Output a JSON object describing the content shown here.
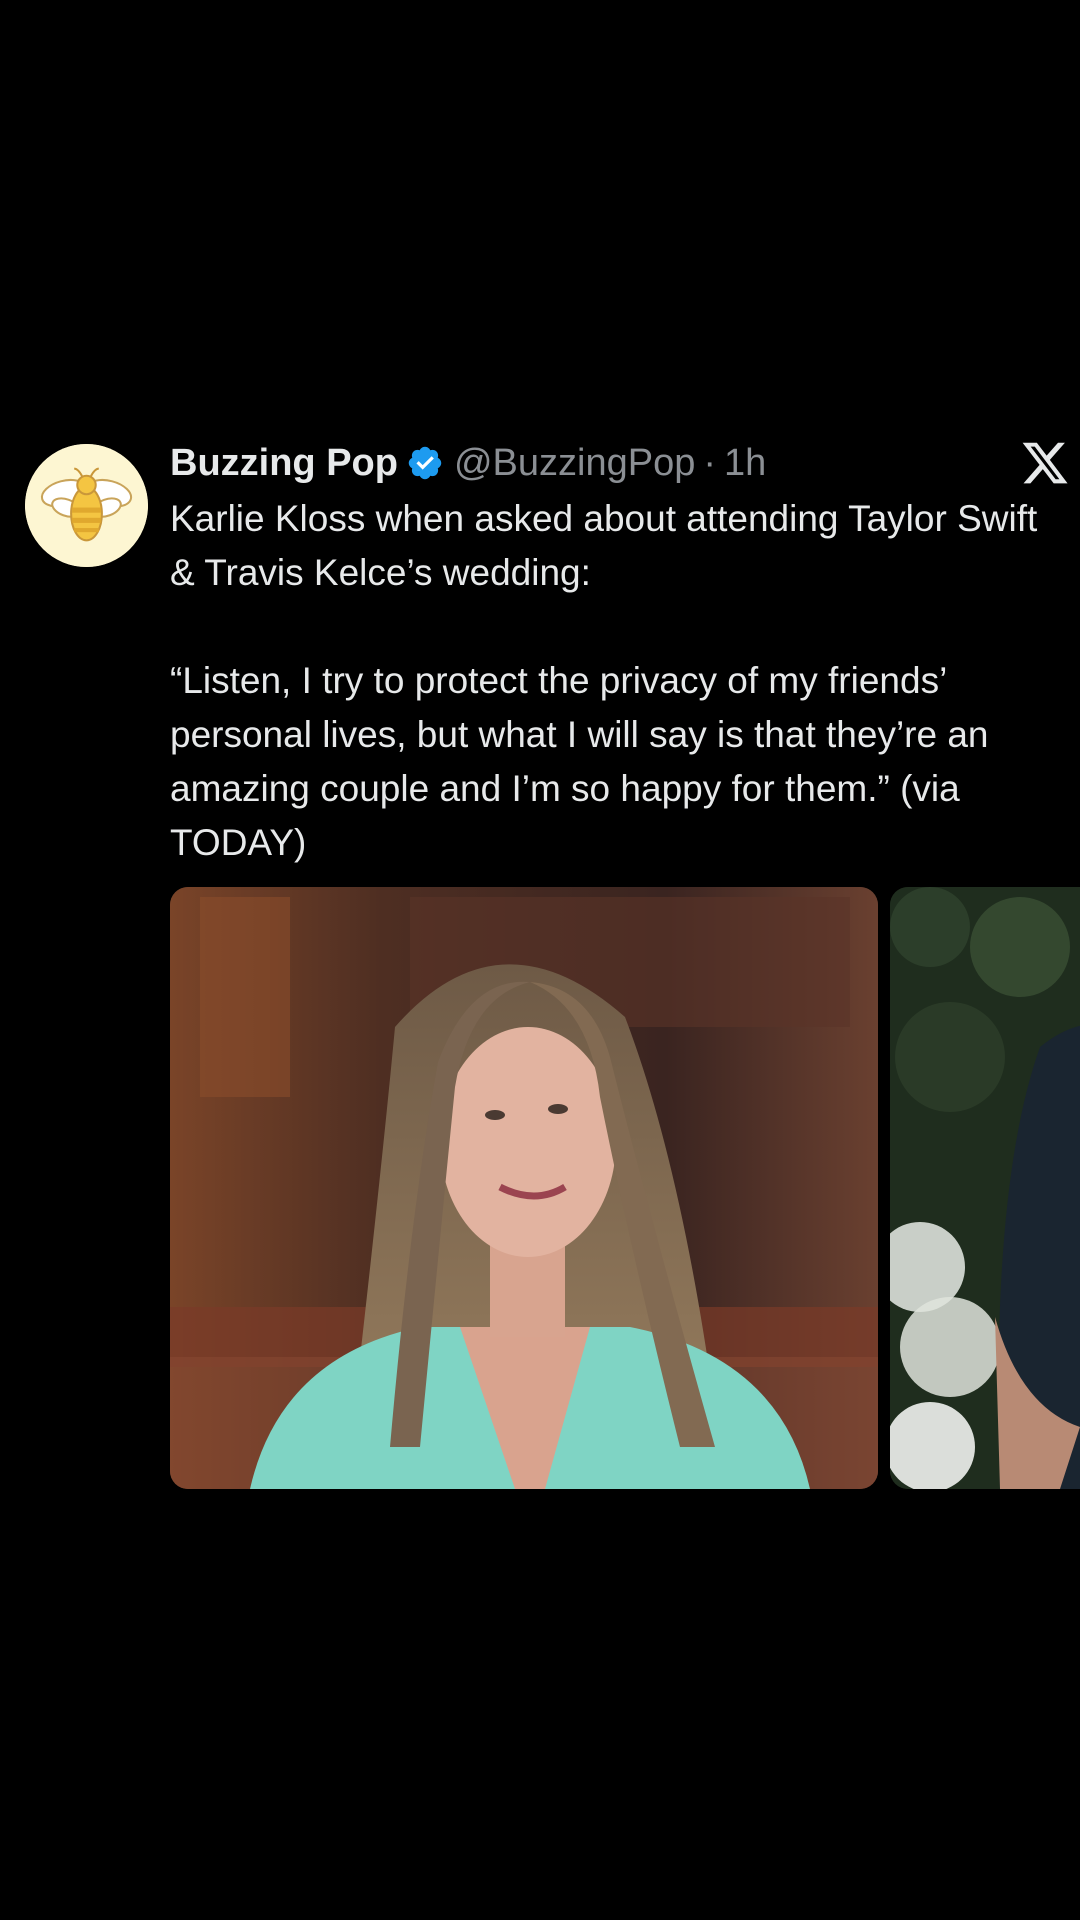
{
  "tweet": {
    "display_name": "Buzzing Pop",
    "handle": "@BuzzingPop",
    "separator": "·",
    "time": "1h",
    "text_line_1": "Karlie Kloss when asked about attending Taylor Swift & Travis Kelce’s wedding:",
    "text_line_2": "“Listen, I try to protect the privacy of my friends’ personal lives, but what I will say is that they’re an amazing couple and I’m so happy for them.” (via TODAY)",
    "avatar_icon": "bee-icon",
    "verified_icon": "verified-badge-icon",
    "brand_icon": "x-logo-icon"
  },
  "media": [
    {
      "kind": "photo",
      "subject": "woman with long hair in teal blazer"
    },
    {
      "kind": "photo",
      "subject": "man in dark shirt near flowers"
    }
  ],
  "colors": {
    "background": "#000000",
    "text_primary": "#e7e9ea",
    "text_secondary": "#8b8f94",
    "verified_blue": "#1d9bf0",
    "avatar_bg": "#fdf6d2"
  }
}
